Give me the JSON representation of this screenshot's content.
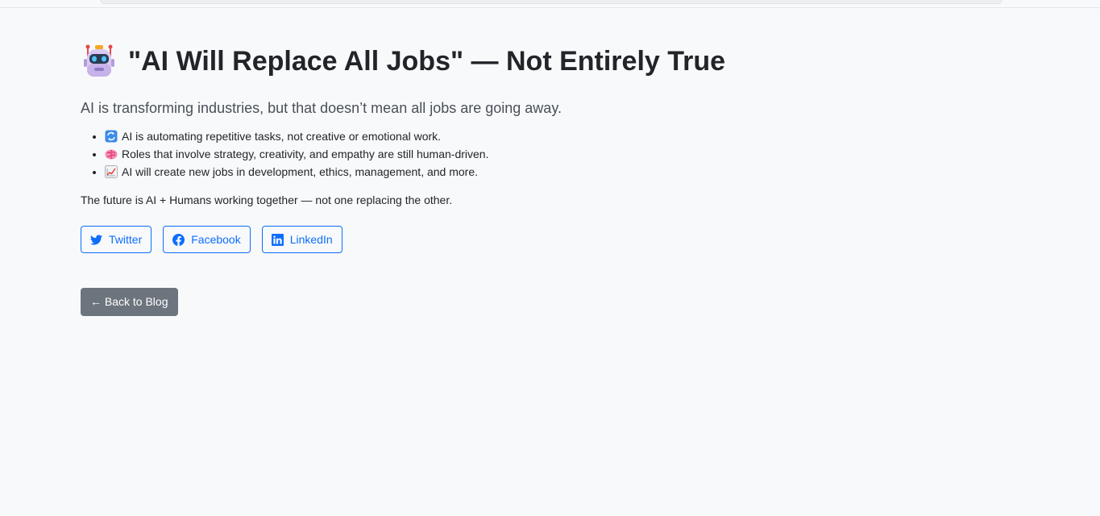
{
  "article": {
    "title": "\"AI Will Replace All Jobs\" — Not Entirely True",
    "title_icon": "robot-icon",
    "lead": "AI is transforming industries, but that doesn’t mean all jobs are going away.",
    "points": [
      {
        "icon": "repeat-icon",
        "text": "AI is automating repetitive tasks, not creative or emotional work."
      },
      {
        "icon": "brain-icon",
        "text": "Roles that involve strategy, creativity, and empathy are still human-driven."
      },
      {
        "icon": "chart-increasing-icon",
        "text": "AI will create new jobs in development, ethics, management, and more."
      }
    ],
    "closing": "The future is AI + Humans working together — not one replacing the other."
  },
  "share": {
    "twitter_label": "Twitter",
    "facebook_label": "Facebook",
    "linkedin_label": "LinkedIn"
  },
  "navigation": {
    "back_label": "← Back to Blog"
  },
  "colors": {
    "primary": "#0d6efd",
    "secondary": "#6c757d",
    "background": "#f8f9fa",
    "text": "#212529"
  }
}
